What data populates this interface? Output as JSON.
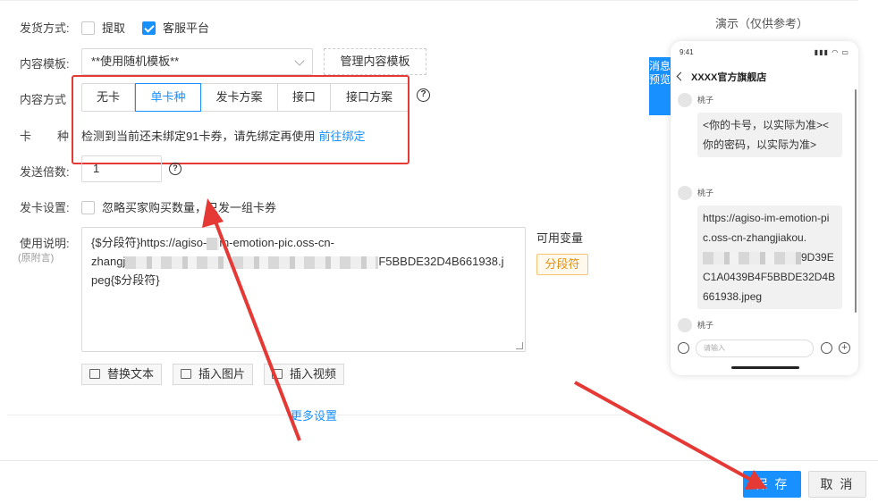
{
  "form": {
    "delivery": {
      "label": "发货方式:",
      "options": [
        {
          "label": "提取",
          "checked": false
        },
        {
          "label": "客服平台",
          "checked": true
        }
      ]
    },
    "template": {
      "label": "内容模板:",
      "value": "**使用随机模板**",
      "manage_label": "管理内容模板"
    },
    "content_mode": {
      "label": "内容方式",
      "tabs": [
        {
          "label": "无卡",
          "active": false
        },
        {
          "label": "单卡种",
          "active": true
        },
        {
          "label": "发卡方案",
          "active": false
        },
        {
          "label": "接口",
          "active": false
        },
        {
          "label": "接口方案",
          "active": false
        }
      ]
    },
    "card_type": {
      "label_1": "卡",
      "label_2": "种",
      "notice": "检测到当前还未绑定91卡券，请先绑定再使用",
      "link": "前往绑定"
    },
    "multiplier": {
      "label": "发送倍数:",
      "value": "1"
    },
    "card_setting": {
      "label": "发卡设置:",
      "option": "忽略买家购买数量，只发一组卡券",
      "checked": false
    },
    "instructions": {
      "label": "使用说明:",
      "sublabel": "(原附言)",
      "text_start": "{$分段符}https://agiso-",
      "text_mid": "m-emotion-pic.oss-cn-",
      "text_line2a": "zhangj",
      "text_line2b": "F5BBDE32D4B661938.j",
      "text_line3": "peg{$分段符}"
    },
    "variables": {
      "title": "可用变量",
      "tag": "分段符"
    },
    "tools": [
      {
        "label": "替换文本"
      },
      {
        "label": "插入图片"
      },
      {
        "label": "插入视频"
      }
    ],
    "more_label": "更多设置"
  },
  "footer": {
    "save_label": "保 存",
    "cancel_label": "取 消"
  },
  "preview": {
    "title": "演示（仅供参考）",
    "tab_label": "消息预览",
    "status_time": "9:41",
    "status_icons": "▮▮▮ ◠ ▭",
    "shop_name": "XXXX官方旗舰店",
    "messages": [
      {
        "sender": "桃子",
        "text": "<你的卡号，以实际为准><你的密码，以实际为准>"
      },
      {
        "sender": "桃子",
        "text_a": "https://agiso-im-emotion-pic.oss-cn-zhangjiakou.",
        "text_b": "9D39EC1A0439B4F5BBDE32D4B661938.jpeg"
      },
      {
        "sender": "桃子"
      }
    ],
    "input_placeholder": "请输入"
  },
  "colors": {
    "accent": "#1890ff",
    "annotation": "#e53935",
    "variable_tag": "#e0921b"
  }
}
